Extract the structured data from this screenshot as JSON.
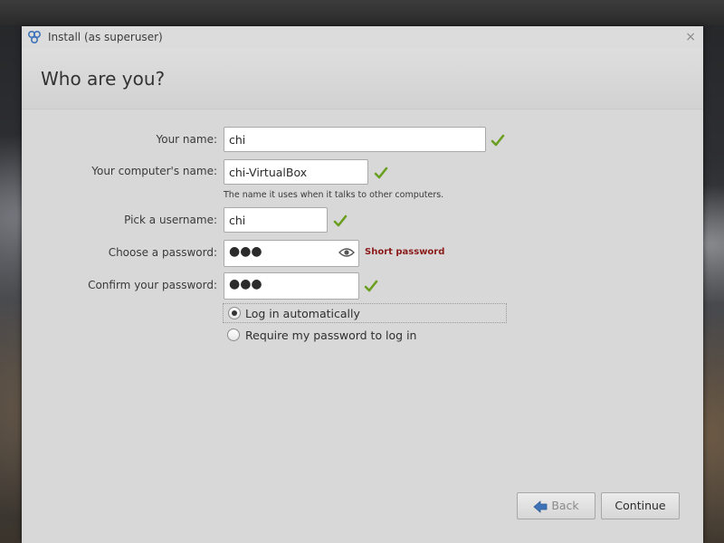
{
  "window": {
    "title": "Install (as superuser)",
    "close_glyph": "×"
  },
  "page": {
    "title": "Who are you?"
  },
  "form": {
    "name_label": "Your name:",
    "name_value": "chi",
    "computer_label": "Your computer's name:",
    "computer_value": "chi-VirtualBox",
    "computer_hint": "The name it uses when it talks to other computers.",
    "username_label": "Pick a username:",
    "username_value": "chi",
    "password_label": "Choose a password:",
    "password_value": "●●●",
    "password_strength": "Short password",
    "confirm_label": "Confirm your password:",
    "confirm_value": "●●●",
    "login_auto_label": "Log in automatically",
    "login_auto_selected": true,
    "require_password_label": "Require my password to log in",
    "require_password_selected": false
  },
  "buttons": {
    "back_label": "Back",
    "continue_label": "Continue"
  },
  "colors": {
    "check_green": "#6a9e1f",
    "warning_red": "#8b1a1a",
    "back_arrow_blue": "#3f73b8"
  },
  "icons": {
    "app": "installer-icon",
    "valid": "checkmark-icon",
    "reveal": "eye-icon",
    "back": "arrow-left-icon"
  }
}
